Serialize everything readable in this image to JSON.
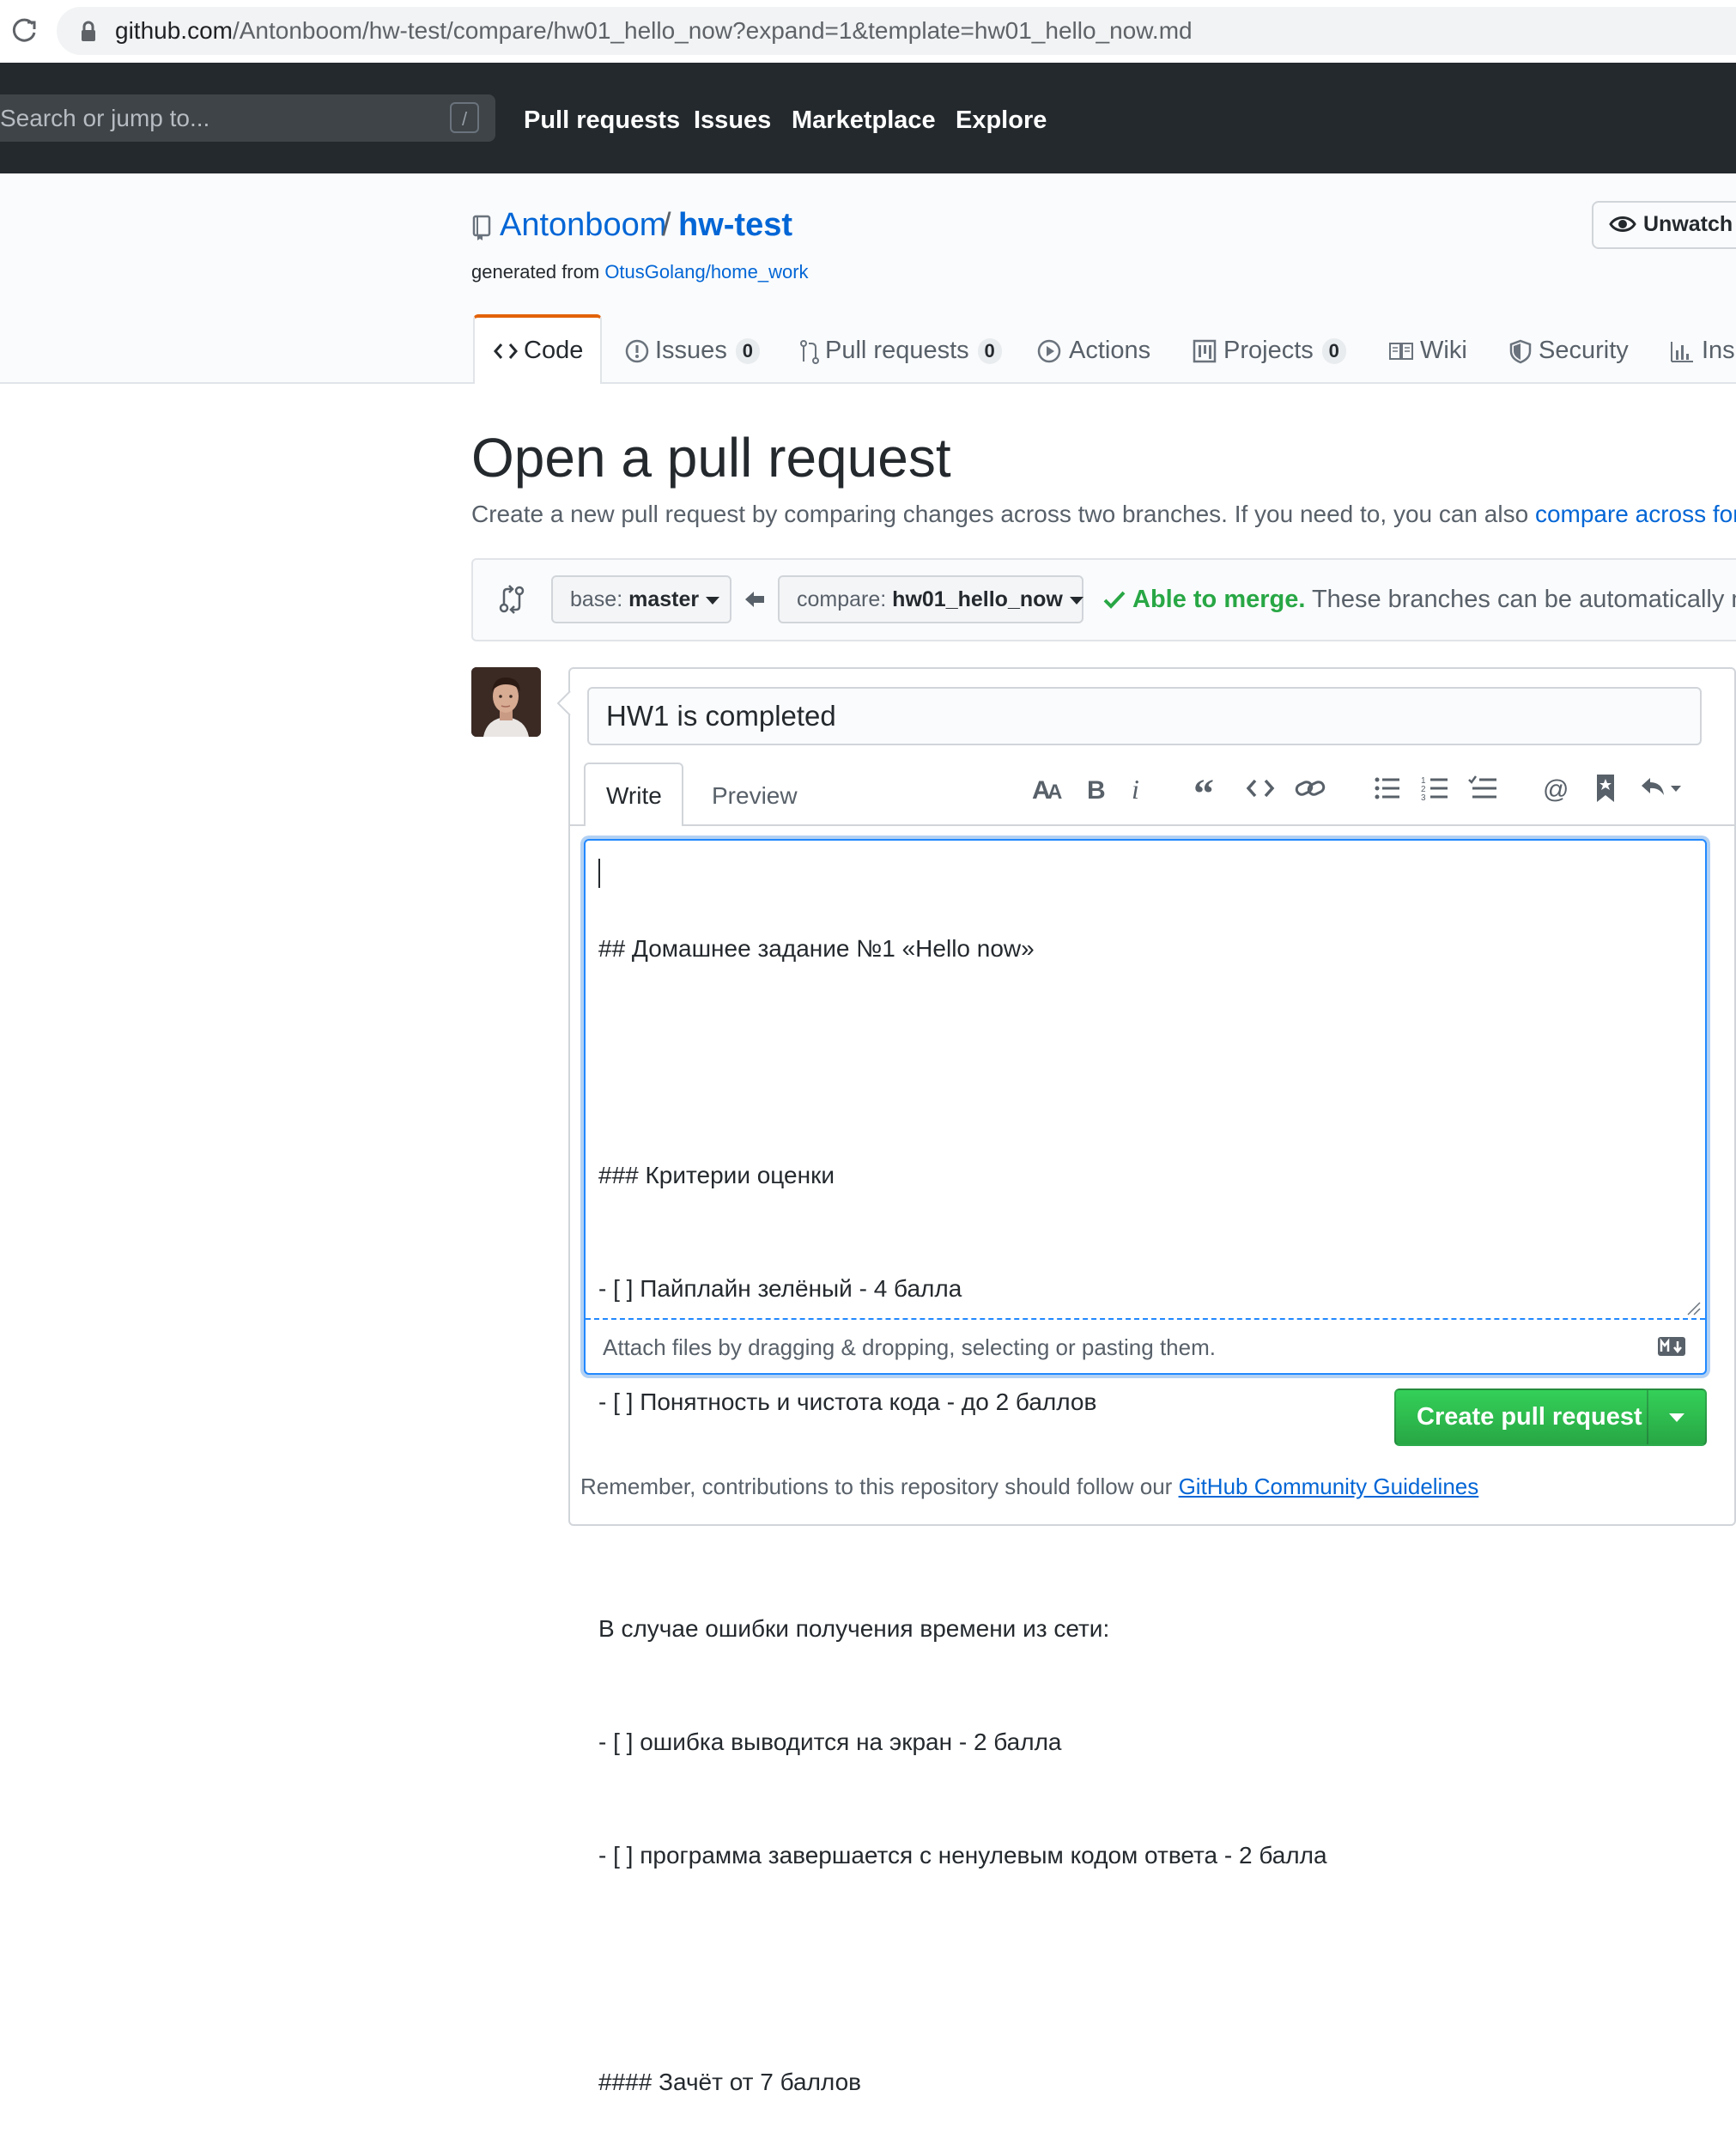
{
  "browser": {
    "url_host": "github.com",
    "url_path": "/Antonboom/hw-test/compare/hw01_hello_now?expand=1&template=hw01_hello_now.md"
  },
  "header": {
    "search_placeholder": "Search or jump to...",
    "search_shortcut": "/",
    "nav": [
      "Pull requests",
      "Issues",
      "Marketplace",
      "Explore"
    ]
  },
  "repo": {
    "owner": "Antonboom",
    "separator": "/",
    "name": "hw-test",
    "generated_prefix": "generated from ",
    "generated_link": "OtusGolang/home_work",
    "unwatch_label": "Unwatch"
  },
  "tabs": [
    {
      "label": "Code",
      "icon": "code-icon"
    },
    {
      "label": "Issues",
      "count": "0",
      "icon": "issue-icon"
    },
    {
      "label": "Pull requests",
      "count": "0",
      "icon": "pull-request-icon"
    },
    {
      "label": "Actions",
      "icon": "play-icon"
    },
    {
      "label": "Projects",
      "count": "0",
      "icon": "project-icon"
    },
    {
      "label": "Wiki",
      "icon": "book-icon"
    },
    {
      "label": "Security",
      "icon": "shield-icon"
    },
    {
      "label": "Insi",
      "icon": "graph-icon"
    }
  ],
  "page": {
    "title": "Open a pull request",
    "subtitle": "Create a new pull request by comparing changes across two branches. If you need to, you can also ",
    "subtitle_link": "compare across forks"
  },
  "range": {
    "base_prefix": "base: ",
    "base_branch": "master",
    "compare_prefix": "compare: ",
    "compare_branch": "hw01_hello_now",
    "merge_ok": "Able to merge.",
    "merge_text": " These branches can be automatically mer"
  },
  "form": {
    "title_value": "HW1 is completed",
    "write_tab": "Write",
    "preview_tab": "Preview",
    "body_lines": [
      "## Домашнее задание №1 «Hello now»",
      "",
      "### Критерии оценки",
      "- [ ] Пайплайн зелёный - 4 балла",
      "- [ ] Понятность и чистота кода - до 2 баллов",
      "",
      "В случае ошибки получения времени из сети:",
      "- [ ] ошибка выводится на экран - 2 балла",
      "- [ ] программа завершается с ненулевым кодом ответа - 2 балла",
      "",
      "#### Зачёт от 7 баллов"
    ],
    "attach_text": "Attach files by dragging & dropping, selecting or pasting them.",
    "create_label": "Create pull request",
    "footnote_prefix": "Remember, contributions to this repository should follow our ",
    "footnote_link": "GitHub Community Guidelines"
  },
  "colors": {
    "header_bg": "#24292e",
    "link": "#0366d6",
    "success": "#28a745",
    "active_tab_accent": "#e36209"
  }
}
